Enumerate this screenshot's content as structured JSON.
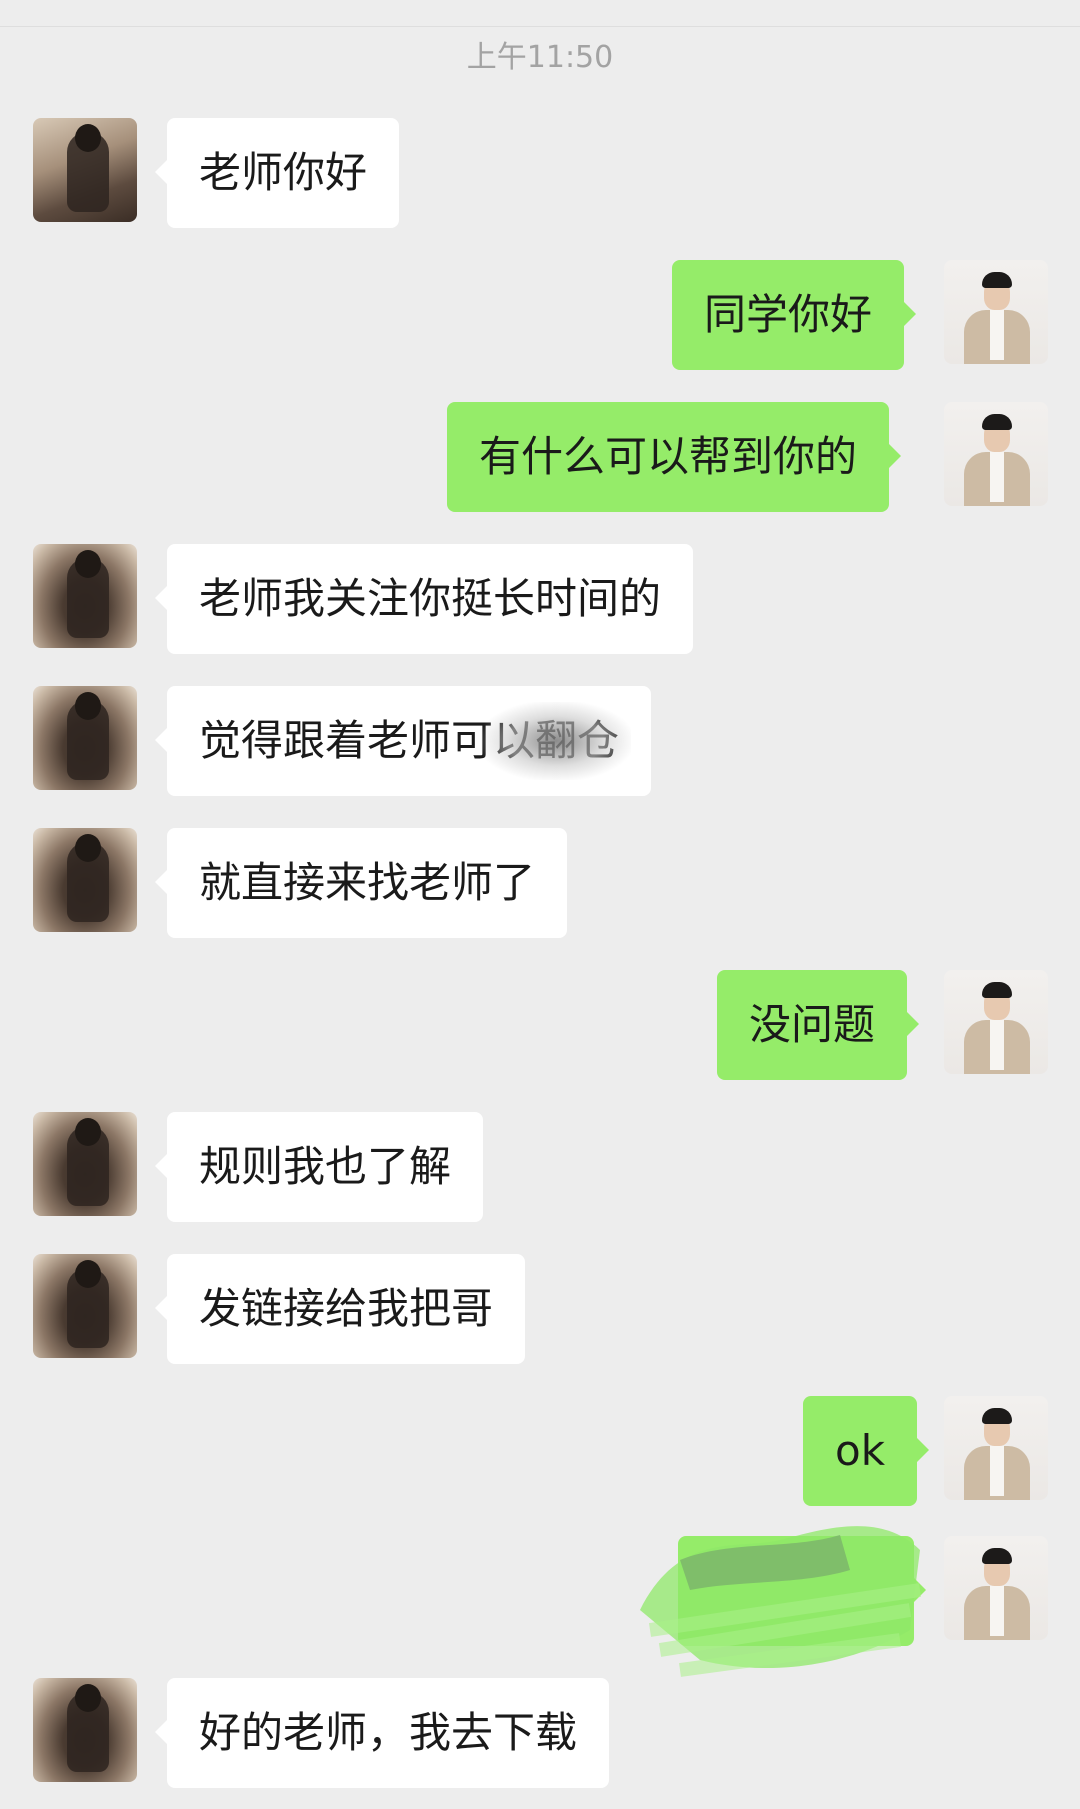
{
  "timestamp": "上午11:50",
  "colors": {
    "background": "#ededed",
    "incoming_bubble": "#ffffff",
    "outgoing_bubble": "#95ec69",
    "timestamp_text": "#a3a3a3"
  },
  "messages": [
    {
      "side": "left",
      "text": "老师你好"
    },
    {
      "side": "right",
      "text": "同学你好"
    },
    {
      "side": "right",
      "text": "有什么可以帮到你的"
    },
    {
      "side": "left",
      "text": "老师我关注你挺长时间的"
    },
    {
      "side": "left",
      "text": "觉得跟着老师可以翻仓"
    },
    {
      "side": "left",
      "text": "就直接来找老师了"
    },
    {
      "side": "right",
      "text": "没问题"
    },
    {
      "side": "left",
      "text": "规则我也了解"
    },
    {
      "side": "left",
      "text": "发链接给我把哥"
    },
    {
      "side": "right",
      "text": "ok"
    },
    {
      "side": "right",
      "text": ""
    },
    {
      "side": "left",
      "text": "好的老师，我去下载"
    }
  ],
  "icons": {
    "incoming_avatar": "girl-photo-avatar-icon",
    "outgoing_avatar": "man-photo-avatar-icon"
  }
}
